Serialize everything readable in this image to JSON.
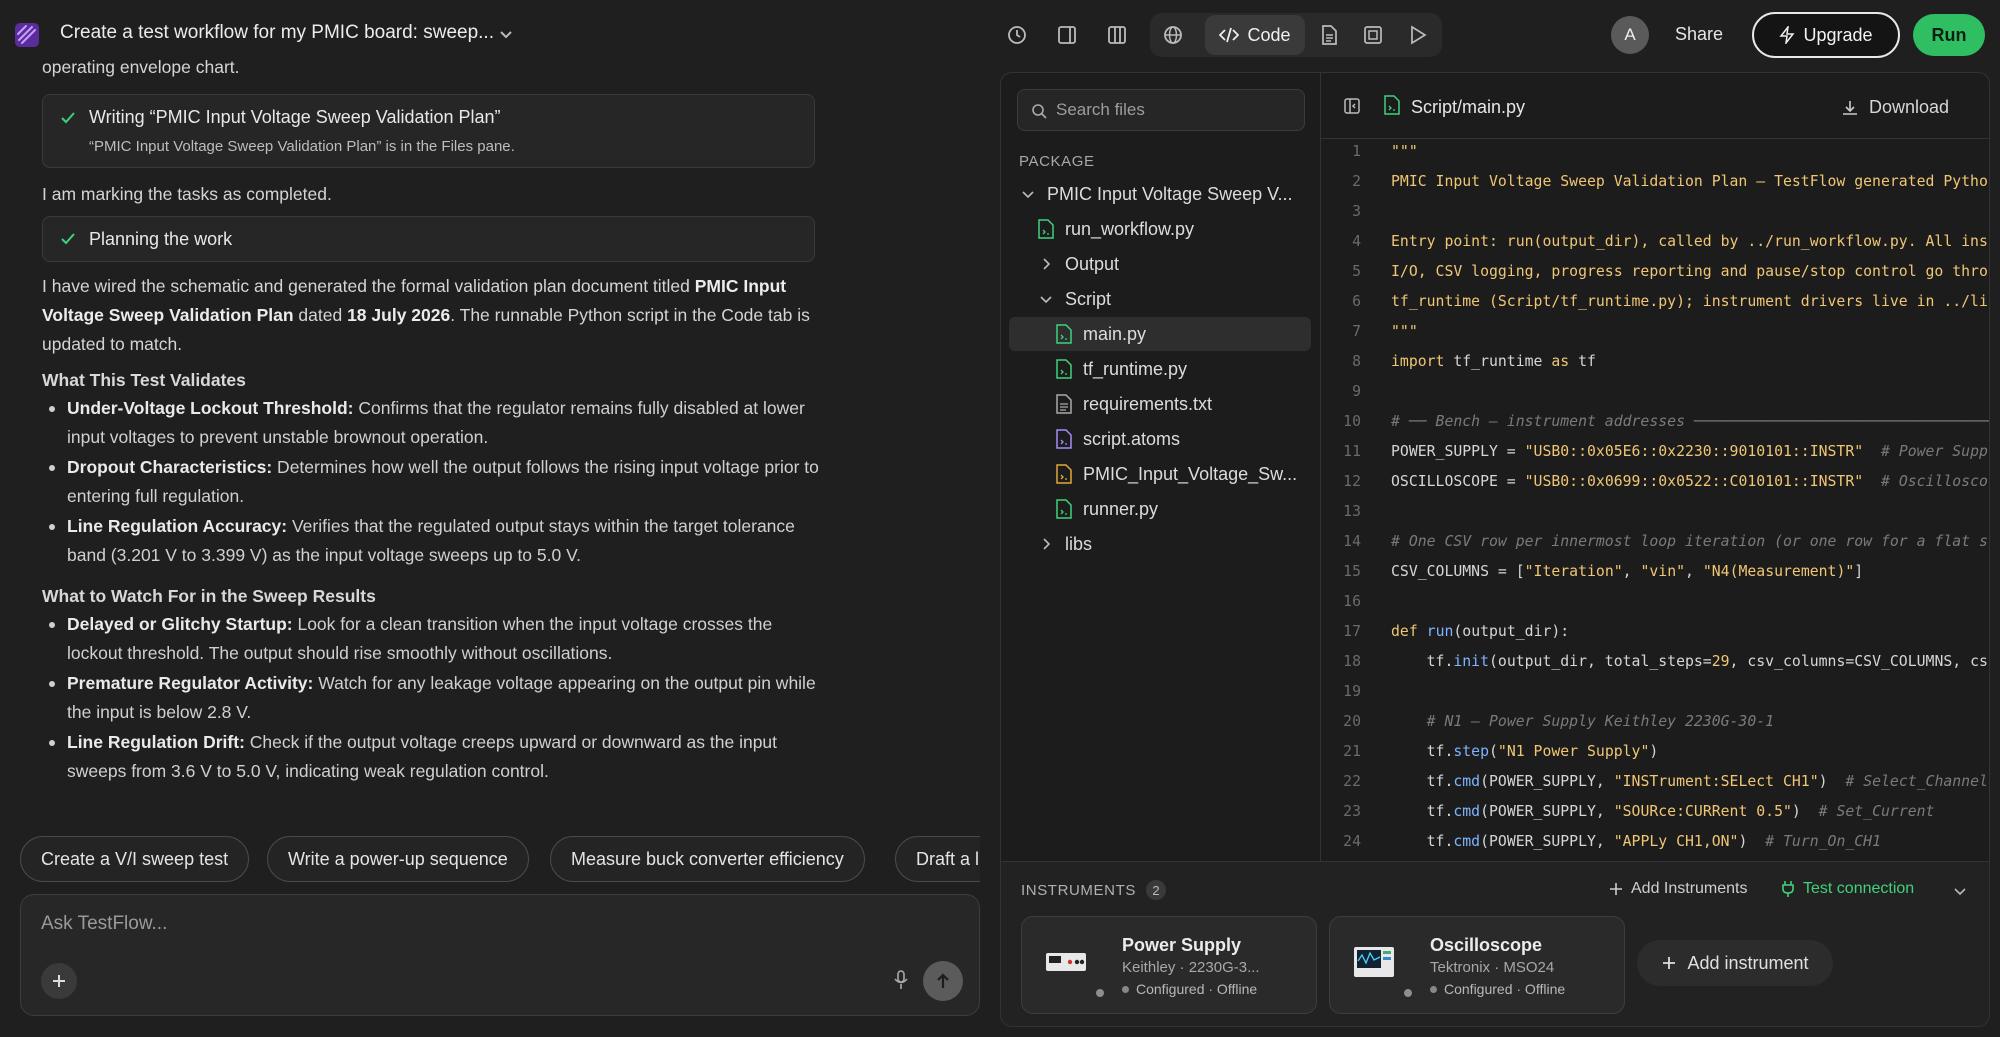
{
  "header": {
    "title": "Create a test workflow for my PMIC board: sweep...",
    "code_label": "Code",
    "avatar_initial": "A",
    "share_label": "Share",
    "upgrade_label": "Upgrade",
    "run_label": "Run"
  },
  "chat": {
    "partial_top": "operating envelope chart.",
    "step1_title": "Writing “PMIC Input Voltage Sweep Validation Plan”",
    "step1_sub": "“PMIC Input Voltage Sweep Validation Plan” is in the Files pane.",
    "marking": "I am marking the tasks as completed.",
    "step2_title": "Planning the work",
    "summary_a": "I have wired the schematic and generated the formal validation plan document titled ",
    "summary_b": "PMIC Input Voltage Sweep Validation Plan",
    "summary_c": " dated ",
    "summary_d": "18 July 2026",
    "summary_e": ". The runnable Python script in the Code tab is updated to match.",
    "section1": "What This Test Validates",
    "s1_items": [
      {
        "bold": "Under-Voltage Lockout Threshold:",
        "text": " Confirms that the regulator remains fully disabled at lower input voltages to prevent unstable brownout operation."
      },
      {
        "bold": "Dropout Characteristics:",
        "text": " Determines how well the output follows the rising input voltage prior to entering full regulation."
      },
      {
        "bold": "Line Regulation Accuracy:",
        "text": " Verifies that the regulated output stays within the target tolerance band (3.201 V to 3.399 V) as the input voltage sweeps up to 5.0 V."
      }
    ],
    "section2": "What to Watch For in the Sweep Results",
    "s2_items": [
      {
        "bold": "Delayed or Glitchy Startup:",
        "text": " Look for a clean transition when the input voltage crosses the lockout threshold. The output should rise smoothly without oscillations."
      },
      {
        "bold": "Premature Regulator Activity:",
        "text": " Watch for any leakage voltage appearing on the output pin while the input is below 2.8 V."
      },
      {
        "bold": "Line Regulation Drift:",
        "text": " Check if the output voltage creeps upward or downward as the input sweeps from 3.6 V to 5.0 V, indicating weak regulation control."
      }
    ],
    "chips": [
      "Create a V/I sweep test",
      "Write a power-up sequence",
      "Measure buck converter efficiency",
      "Draft a l"
    ],
    "composer_placeholder": "Ask TestFlow..."
  },
  "files": {
    "search_placeholder": "Search files",
    "package_label": "PACKAGE",
    "root": "PMIC Input Voltage Sweep V...",
    "run_workflow": "run_workflow.py",
    "output_folder": "Output",
    "script_folder": "Script",
    "script_files": [
      "main.py",
      "tf_runtime.py",
      "requirements.txt",
      "script.atoms",
      "PMIC_Input_Voltage_Sw...",
      "runner.py"
    ],
    "libs_folder": "libs"
  },
  "editor": {
    "path": "Script/main.py",
    "download_label": "Download",
    "lines": [
      "1",
      "2",
      "3",
      "4",
      "5",
      "6",
      "7",
      "8",
      "9",
      "10",
      "11",
      "12",
      "13",
      "14",
      "15",
      "16",
      "17",
      "18",
      "19",
      "20",
      "21",
      "22",
      "23",
      "24"
    ]
  },
  "instruments": {
    "label": "INSTRUMENTS",
    "count": "2",
    "add_link": "Add Instruments",
    "test_connection": "Test connection",
    "items": [
      {
        "name": "Power Supply",
        "model": "Keithley · 2230G-3...",
        "status": "Configured · Offline"
      },
      {
        "name": "Oscilloscope",
        "model": "Tektronix · MSO24",
        "status": "Configured · Offline"
      }
    ],
    "add_button": "Add instrument"
  },
  "colors": {
    "accent_green": "#2fbf62",
    "code_string": "#f0c674",
    "code_function": "#7fb3ff"
  }
}
